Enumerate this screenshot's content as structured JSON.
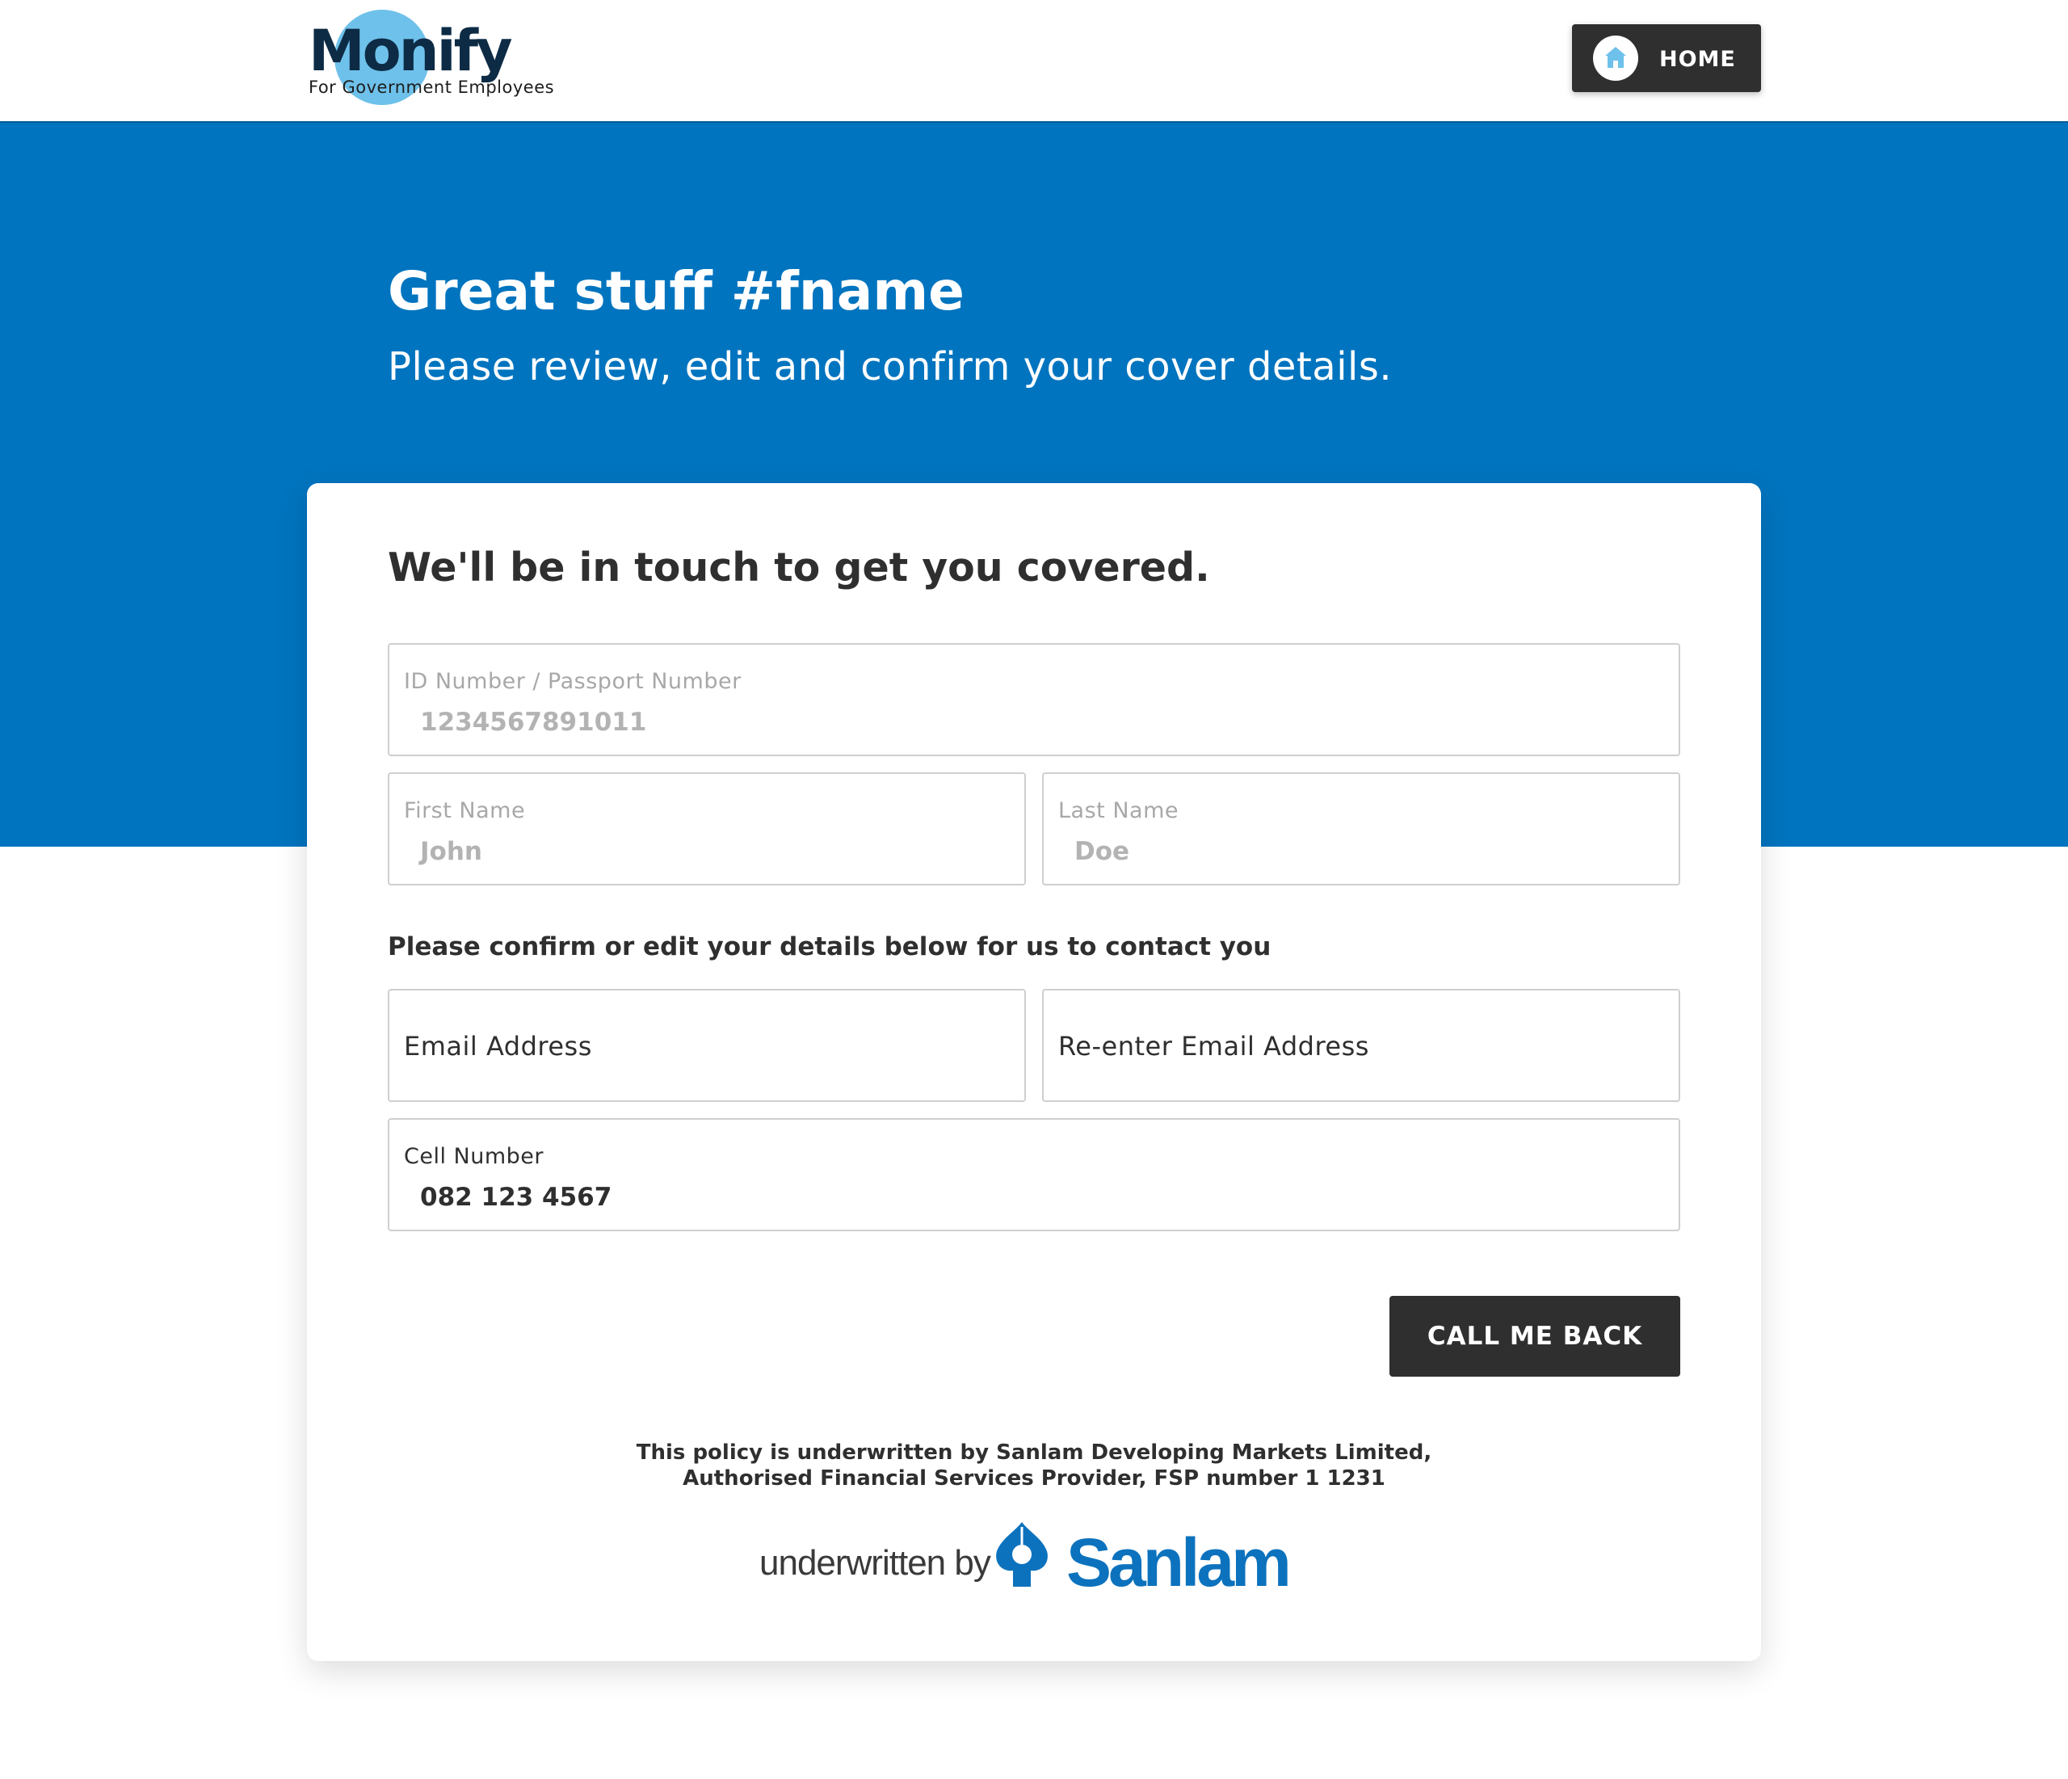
{
  "header": {
    "logo_text": "Monify",
    "logo_sub": "For Government Employees",
    "home_label": "HOME"
  },
  "hero": {
    "title": "Great stuff #fname",
    "subtitle": "Please review, edit and confirm your cover details."
  },
  "card": {
    "title": "We'll be in touch to get you covered.",
    "id_field": {
      "label": "ID Number / Passport Number",
      "value": "1234567891011"
    },
    "first_name": {
      "label": "First Name",
      "value": "John"
    },
    "last_name": {
      "label": "Last Name",
      "value": "Doe"
    },
    "contact_prompt": "Please confirm or edit your details below for us to contact you",
    "email": {
      "placeholder": "Email Address"
    },
    "email_confirm": {
      "placeholder": "Re-enter Email Address"
    },
    "cell": {
      "label": "Cell Number",
      "value": "082 123 4567"
    },
    "cta_label": "CALL ME BACK",
    "disclaimer_line1": "This policy is underwritten by Sanlam Developing Markets Limited,",
    "disclaimer_line2": "Authorised Financial Services Provider, FSP number 1 1231",
    "underwritten_by": "underwritten by",
    "underwriter_brand": "Sanlam"
  },
  "colors": {
    "brand_blue": "#0074bf",
    "logo_circle": "#6ec1ea",
    "dark_button": "#2f2f2f",
    "sanlam_blue": "#0c72bd"
  },
  "icons": {
    "home": "home-icon",
    "sanlam": "sanlam-logo-icon"
  }
}
